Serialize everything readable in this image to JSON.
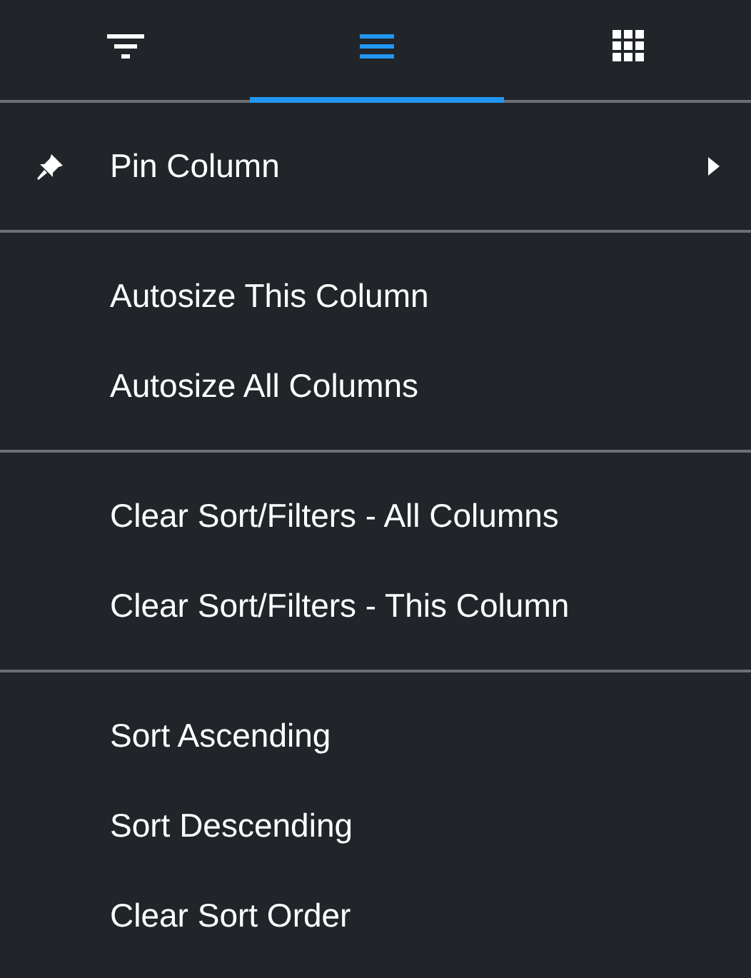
{
  "tabs": [
    {
      "kind": "filter",
      "selected": false
    },
    {
      "kind": "menu",
      "selected": true
    },
    {
      "kind": "grid",
      "selected": false
    }
  ],
  "groups": [
    {
      "items": [
        {
          "kind": "pin",
          "label": "Pin Column",
          "submenu": true
        }
      ]
    },
    {
      "items": [
        {
          "kind": "plain",
          "label": "Autosize This Column",
          "submenu": false
        },
        {
          "kind": "plain",
          "label": "Autosize All Columns",
          "submenu": false
        }
      ]
    },
    {
      "items": [
        {
          "kind": "plain",
          "label": "Clear Sort/Filters - All Columns",
          "submenu": false
        },
        {
          "kind": "plain",
          "label": "Clear Sort/Filters - This Column",
          "submenu": false
        }
      ]
    },
    {
      "items": [
        {
          "kind": "plain",
          "label": "Sort Ascending",
          "submenu": false
        },
        {
          "kind": "plain",
          "label": "Sort Descending",
          "submenu": false
        },
        {
          "kind": "plain",
          "label": "Clear Sort Order",
          "submenu": false
        }
      ]
    }
  ]
}
